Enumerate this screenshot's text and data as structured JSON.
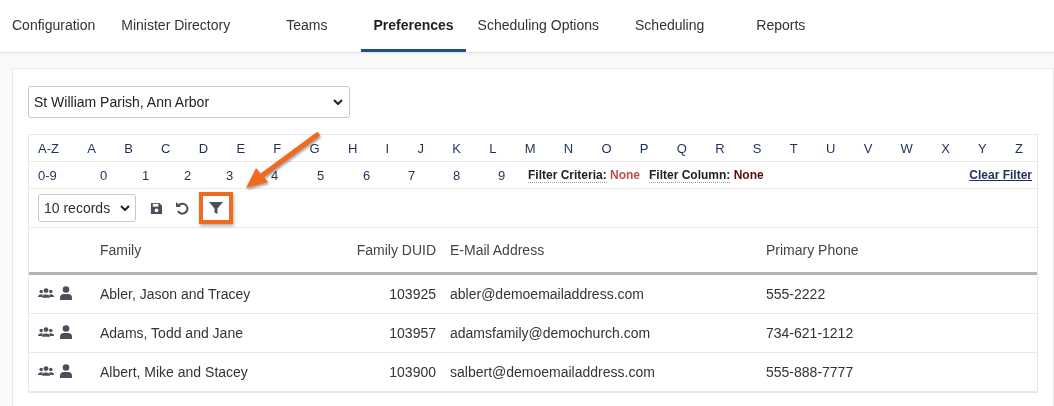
{
  "tabs": [
    {
      "label": "Configuration",
      "selected": false
    },
    {
      "label": "Minister Directory",
      "selected": false
    },
    {
      "label": "Teams",
      "selected": false
    },
    {
      "label": "Preferences",
      "selected": true
    },
    {
      "label": "Scheduling Options",
      "selected": false
    },
    {
      "label": "Scheduling",
      "selected": false
    },
    {
      "label": "Reports",
      "selected": false
    }
  ],
  "parish_select": {
    "value": "St William Parish, Ann Arbor"
  },
  "letters": [
    "A-Z",
    "A",
    "B",
    "C",
    "D",
    "E",
    "F",
    "G",
    "H",
    "I",
    "J",
    "K",
    "L",
    "M",
    "N",
    "O",
    "P",
    "Q",
    "R",
    "S",
    "T",
    "U",
    "V",
    "W",
    "X",
    "Y",
    "Z"
  ],
  "digits": [
    "0-9",
    "0",
    "1",
    "2",
    "3",
    "4",
    "5",
    "6",
    "7",
    "8",
    "9"
  ],
  "filter_criteria": {
    "label": "Filter Criteria:",
    "value": "None"
  },
  "filter_column": {
    "label": "Filter Column:",
    "value": "None"
  },
  "clear_filter": "Clear Filter",
  "records_select": {
    "value": "10 records"
  },
  "toolbar": [
    {
      "kind": "save",
      "highlighted": false
    },
    {
      "kind": "undo",
      "highlighted": false
    },
    {
      "kind": "filter",
      "highlighted": true
    }
  ],
  "callout_arrow": true,
  "table": {
    "columns": [
      "Family",
      "Family DUID",
      "E-Mail Address",
      "Primary Phone"
    ],
    "rows": [
      {
        "family": "Abler, Jason and Tracey",
        "duid": "103925",
        "email": "abler@demoemailaddress.com",
        "phone": "555-2222"
      },
      {
        "family": "Adams, Todd and Jane",
        "duid": "103957",
        "email": "adamsfamily@demochurch.com",
        "phone": "734-621-1212"
      },
      {
        "family": "Albert, Mike and Stacey",
        "duid": "103900",
        "email": "salbert@demoemailaddress.com",
        "phone": "555-888-7777"
      }
    ]
  }
}
